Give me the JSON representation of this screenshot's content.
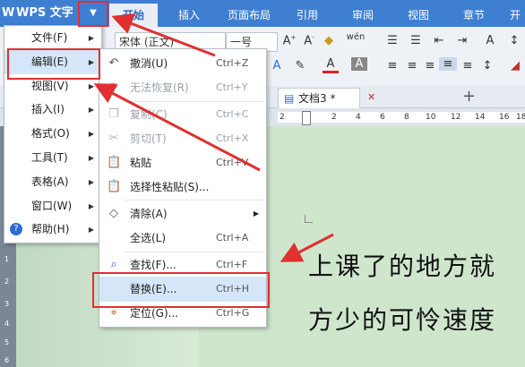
{
  "app": {
    "brand": "WPS 文字",
    "brand_logo": "W",
    "dropdown_glyph": "▼"
  },
  "ribbon_tabs": [
    "开始",
    "插入",
    "页面布局",
    "引用",
    "审阅",
    "视图",
    "章节",
    "开"
  ],
  "toolbar": {
    "font_name": "宋体 (正文)",
    "font_size": "一号"
  },
  "doc_tab": {
    "title": "文档3 *",
    "add": "+"
  },
  "ruler": {
    "numbers": [
      "2",
      "2",
      "4",
      "6",
      "8",
      "10",
      "12",
      "14",
      "16",
      "18"
    ]
  },
  "vertical_ruler": {
    "numbers": [
      "1",
      "2",
      "3",
      "4",
      "5",
      "6"
    ]
  },
  "main_menu": [
    {
      "label": "文件(F)",
      "submenu": true
    },
    {
      "label": "编辑(E)",
      "submenu": true
    },
    {
      "label": "视图(V)",
      "submenu": true
    },
    {
      "label": "插入(I)",
      "submenu": true
    },
    {
      "label": "格式(O)",
      "submenu": true
    },
    {
      "label": "工具(T)",
      "submenu": true
    },
    {
      "label": "表格(A)",
      "submenu": true
    },
    {
      "label": "窗口(W)",
      "submenu": true
    },
    {
      "label": "帮助(H)",
      "submenu": true
    }
  ],
  "edit_menu": [
    {
      "label": "撤消(U)",
      "shortcut": "Ctrl+Z",
      "icon": "undo-icon",
      "enabled": true
    },
    {
      "label": "无法恢复(R)",
      "shortcut": "Ctrl+Y",
      "icon": "redo-icon",
      "enabled": false
    },
    {
      "label": "复制(C)",
      "shortcut": "Ctrl+C",
      "icon": "copy-icon",
      "enabled": false
    },
    {
      "label": "剪切(T)",
      "shortcut": "Ctrl+X",
      "icon": "cut-icon",
      "enabled": false
    },
    {
      "label": "粘贴",
      "shortcut": "Ctrl+V",
      "icon": "paste-icon",
      "enabled": true
    },
    {
      "label": "选择性粘贴(S)...",
      "shortcut": "",
      "icon": "paste-special-icon",
      "enabled": true
    },
    {
      "label": "清除(A)",
      "shortcut": "",
      "icon": "eraser-icon",
      "enabled": true,
      "submenu": true
    },
    {
      "label": "全选(L)",
      "shortcut": "Ctrl+A",
      "icon": "",
      "enabled": true
    },
    {
      "label": "查找(F)...",
      "shortcut": "Ctrl+F",
      "icon": "find-icon",
      "enabled": true
    },
    {
      "label": "替换(E)...",
      "shortcut": "Ctrl+H",
      "icon": "",
      "enabled": true
    },
    {
      "label": "定位(G)...",
      "shortcut": "Ctrl+G",
      "icon": "goto-icon",
      "enabled": true
    }
  ],
  "document": {
    "lines": [
      "上课了的地方就",
      "方少的可怜速度"
    ]
  },
  "colors": {
    "tabbar": "#3f7fd2",
    "highlight": "#d5e6f9",
    "annotation_red": "#e03030",
    "page_bg": "#cfe6cd"
  }
}
